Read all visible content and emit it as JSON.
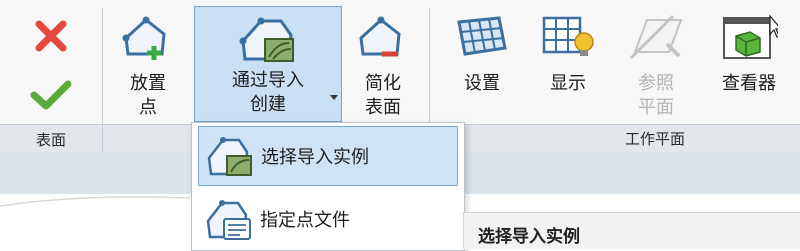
{
  "surface_panel": {
    "label": "表面",
    "cancel_icon": "red-x-icon",
    "confirm_icon": "green-check-icon"
  },
  "buttons": {
    "place_point": "放置\n点",
    "create_from_import": "通过导入\n创建",
    "simplify_surface": "简化\n表面",
    "set": "设置",
    "show": "显示",
    "reference_plane": "参照\n平面",
    "viewer": "查看器"
  },
  "workplane_panel": {
    "label": "工作平面"
  },
  "dropdown": {
    "items": [
      {
        "label": "选择导入实例",
        "icon": "import-instance-icon"
      },
      {
        "label": "指定点文件",
        "icon": "points-file-icon"
      }
    ]
  },
  "tooltip": {
    "title": "选择导入实例"
  },
  "colors": {
    "accent": "#c9dff3",
    "cancel": "#e2483d",
    "confirm": "#5cab3a",
    "icon_blue": "#3b6fa0",
    "bulb": "#f2c230"
  }
}
